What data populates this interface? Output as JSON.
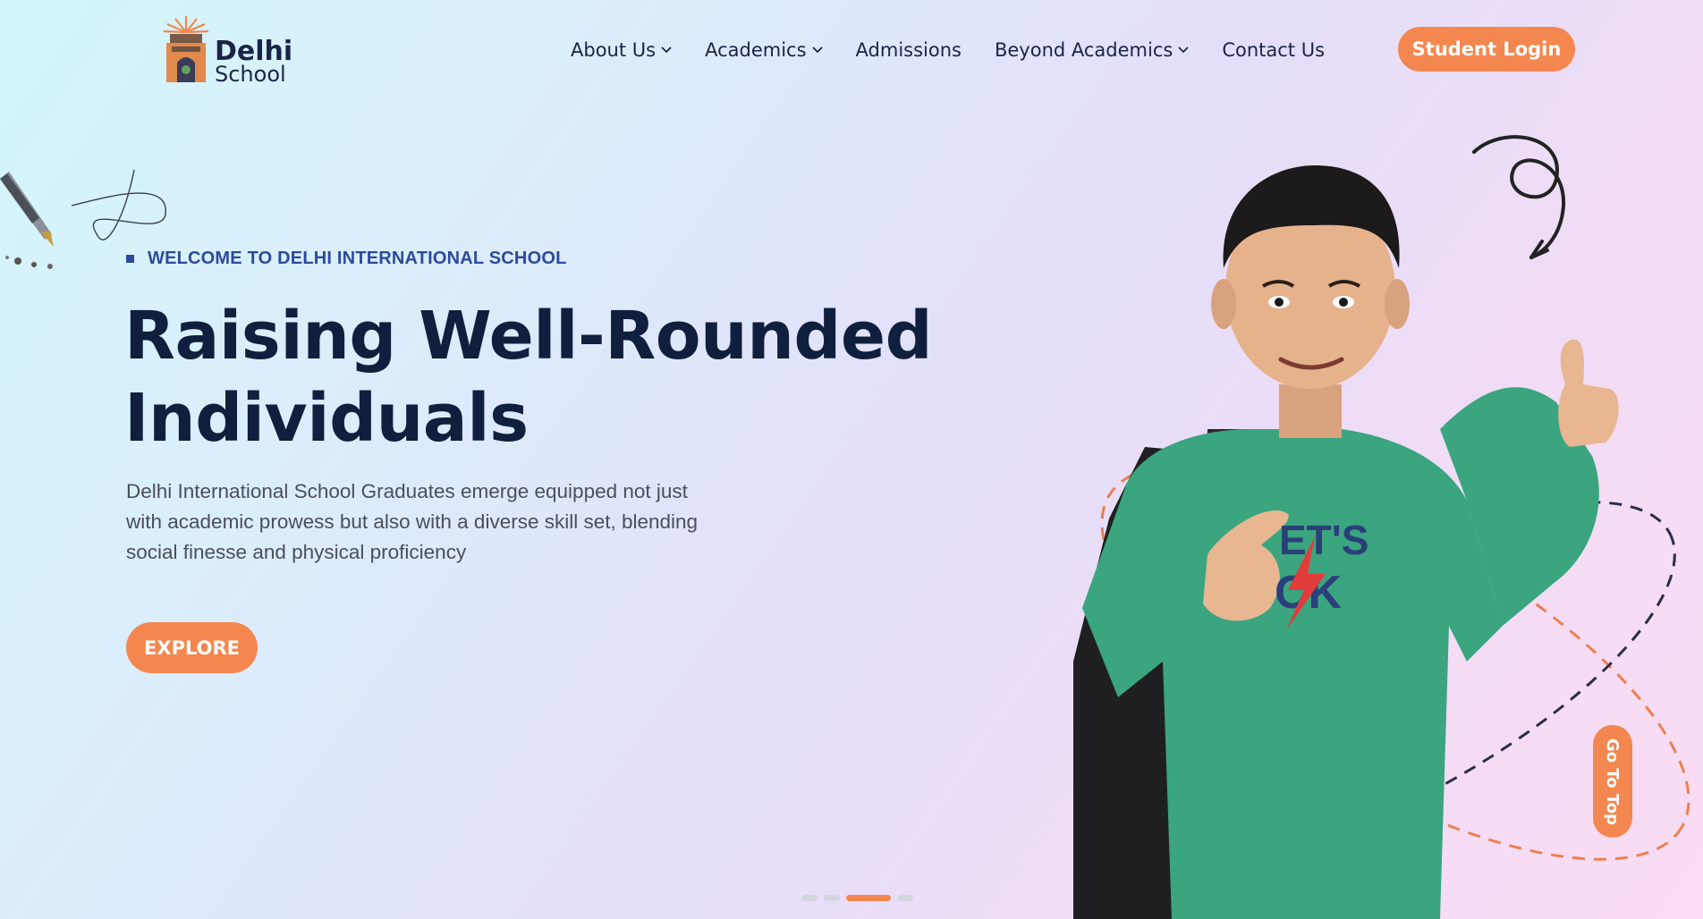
{
  "brand": {
    "logo_line1": "Delhi",
    "logo_line2": "School"
  },
  "nav": {
    "items": [
      {
        "label": "About Us",
        "has_dropdown": true
      },
      {
        "label": "Academics",
        "has_dropdown": true
      },
      {
        "label": "Admissions",
        "has_dropdown": false
      },
      {
        "label": "Beyond Academics",
        "has_dropdown": true
      },
      {
        "label": "Contact Us",
        "has_dropdown": false
      }
    ],
    "login_label": "Student Login"
  },
  "hero": {
    "eyebrow": "WELCOME TO DELHI INTERNATIONAL SCHOOL",
    "headline_line1": "Raising Well-Rounded",
    "headline_line2": "Individuals",
    "description": "Delhi International School Graduates emerge equipped not just with academic prowess but also with a diverse skill set, blending social finesse and physical proficiency",
    "cta_label": "EXPLORE"
  },
  "slider": {
    "total_slides": 4,
    "active_index": 2
  },
  "go_top_label": "Go To Top",
  "colors": {
    "accent": "#f4874f",
    "navy": "#0f1f3d",
    "eyebrow": "#2d4a9c",
    "shirt": "#3aa57e"
  },
  "icons": [
    "chevron-down-icon",
    "pen-icon",
    "swirl-arrow-icon",
    "orbit-ring-icon"
  ]
}
